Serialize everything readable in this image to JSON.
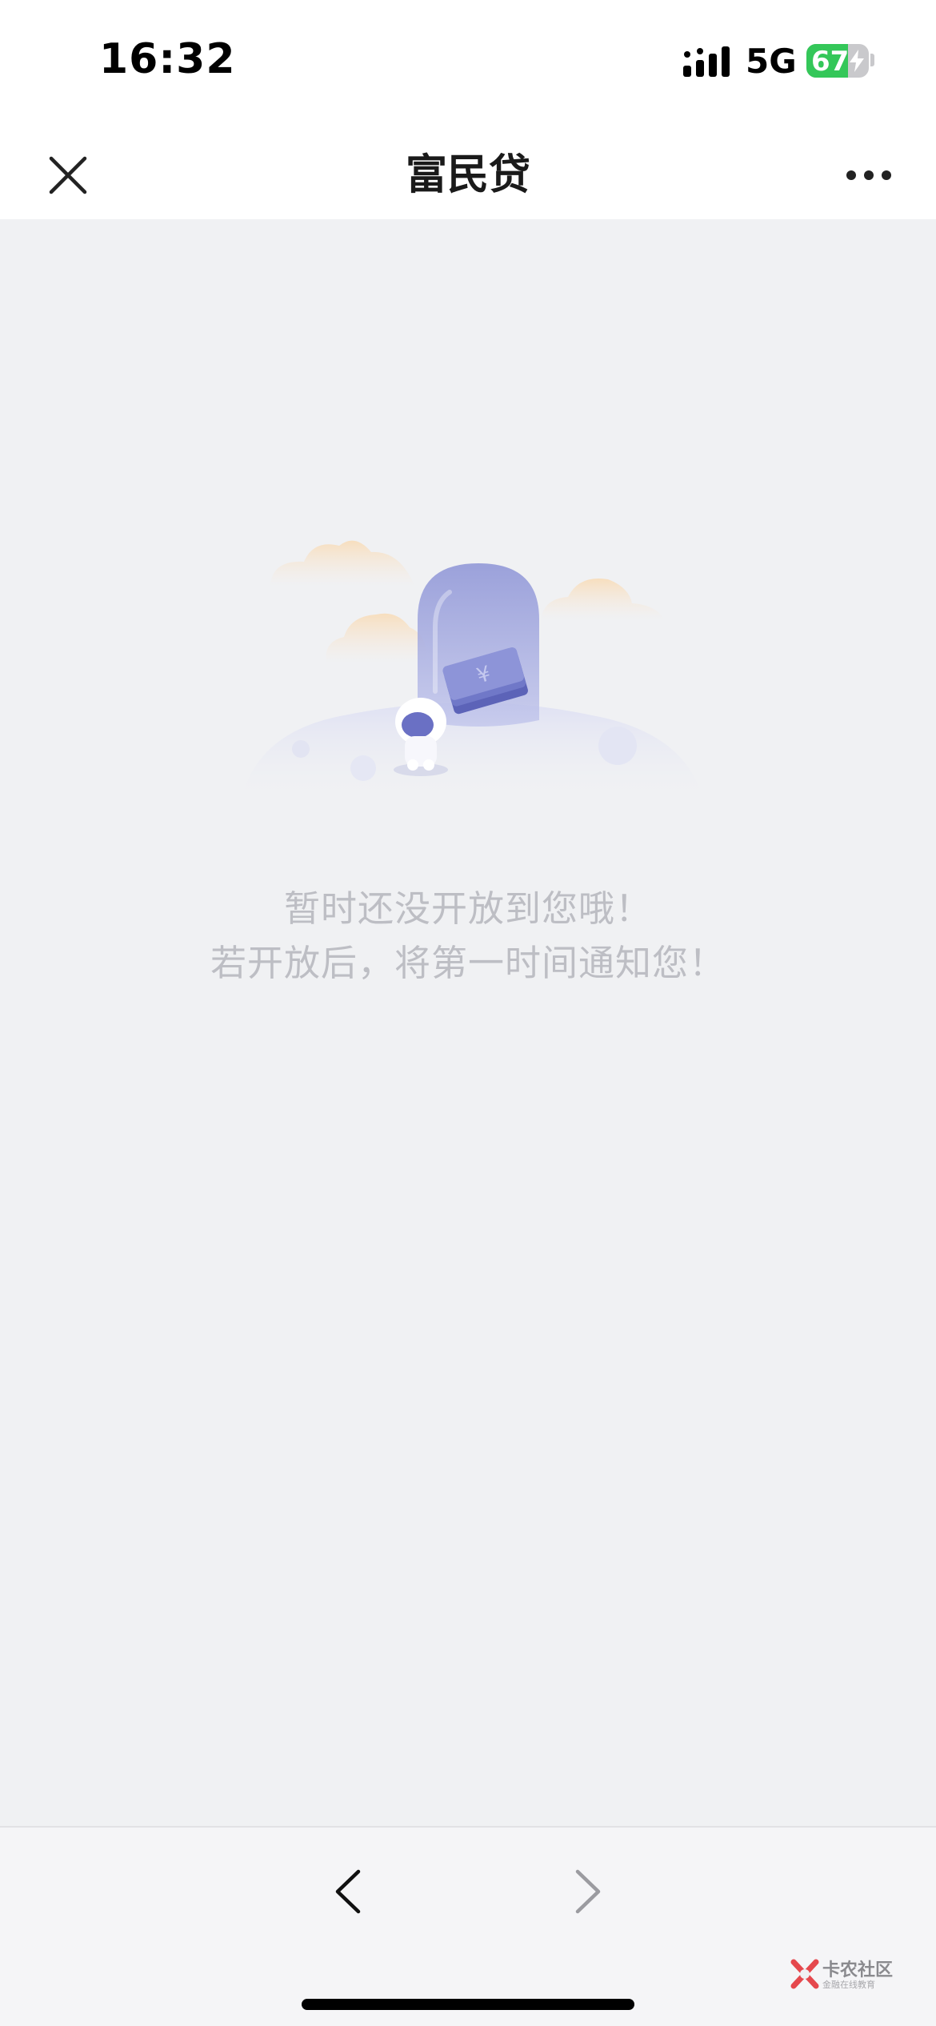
{
  "status_bar": {
    "time": "16:32",
    "network": "5G",
    "battery_percent": 67,
    "battery_label": "67",
    "battery_color": "#34c759",
    "charging": true,
    "icons": [
      "signal-icon",
      "battery-icon",
      "charging-bolt-icon"
    ]
  },
  "nav_bar": {
    "title": "富民贷",
    "left_icon": "close-icon",
    "right_icon": "more-icon"
  },
  "empty_state": {
    "illustration": "empty-state-illustration",
    "line1": "暂时还没开放到您哦！",
    "line2": "若开放后，将第一时间通知您！",
    "text_color": "#bdbec4"
  },
  "bottom_toolbar": {
    "back_icon": "chevron-left-icon",
    "forward_icon": "chevron-right-icon",
    "forward_enabled": false
  },
  "watermark": {
    "title": "卡农社区",
    "subtitle": "金融在线教育"
  }
}
